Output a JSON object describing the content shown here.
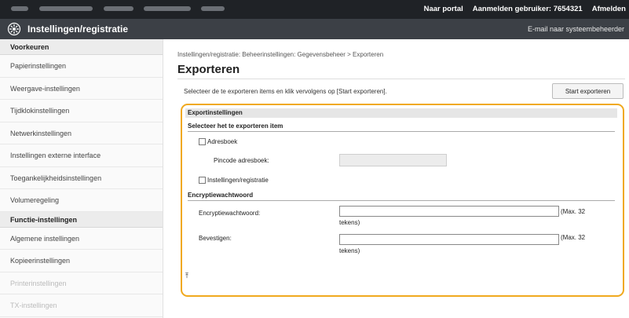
{
  "topbar": {
    "links": [
      "Naar portal",
      "Aanmelden gebruiker: 7654321",
      "Afmelden"
    ]
  },
  "header": {
    "title": "Instellingen/registratie",
    "mail_link": "E-mail naar systeembeheerder"
  },
  "sidebar": {
    "sections": [
      {
        "heading": "Voorkeuren",
        "items": [
          "Papierinstellingen",
          "Weergave-instellingen",
          "Tijdklokinstellingen",
          "Netwerkinstellingen",
          "Instellingen externe interface",
          "Toegankelijkheidsinstellingen",
          "Volumeregeling"
        ]
      },
      {
        "heading": "Functie-instellingen",
        "items": [
          "Algemene instellingen",
          "Kopieerinstellingen",
          "Printerinstellingen",
          "TX-instellingen"
        ]
      }
    ]
  },
  "main": {
    "breadcrumb": "Instellingen/registratie: Beheerinstellingen: Gegevensbeheer > Exporteren",
    "title": "Exporteren",
    "instruction": "Selecteer de te exporteren items en klik vervolgens op [Start exporteren].",
    "start_button": "Start exporteren",
    "section_title": "Exportinstellingen",
    "select_heading": "Selecteer het te exporteren item",
    "addressbook_label": "Adresboek",
    "pin_label": "Pincode adresboek:",
    "settings_label": "Instellingen/registratie",
    "encryption_heading": "Encryptiewachtwoord",
    "enc_password_label": "Encryptiewachtwoord:",
    "confirm_label": "Bevestigen:",
    "max_hint": "(Max. 32",
    "max_hint_wrap": "tekens)",
    "to_top_glyph": "⤒"
  }
}
